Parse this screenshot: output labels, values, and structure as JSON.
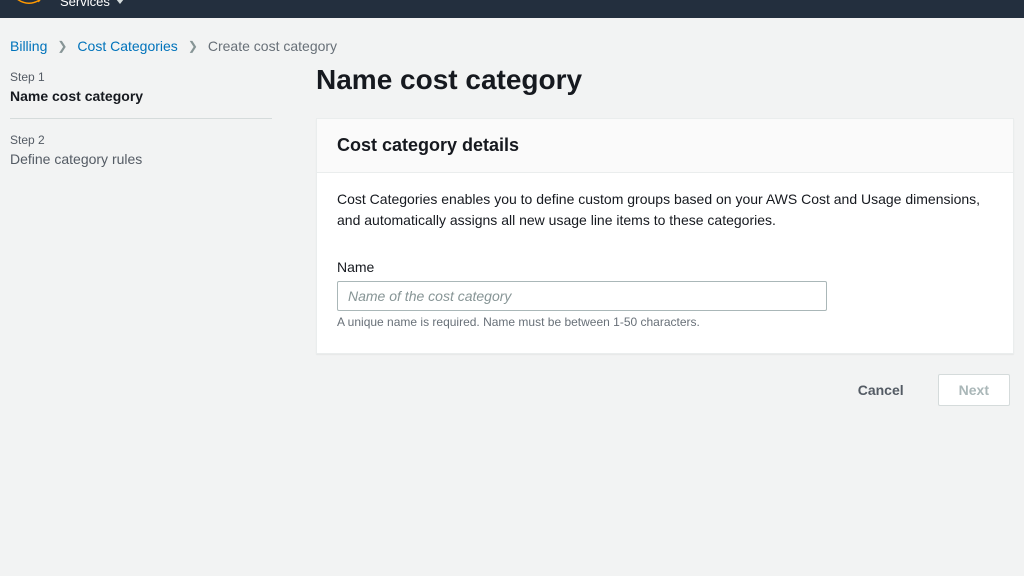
{
  "nav": {
    "services": "Services"
  },
  "breadcrumb": {
    "billing": "Billing",
    "categories": "Cost Categories",
    "current": "Create cost category"
  },
  "steps": [
    {
      "label": "Step 1",
      "title": "Name cost category",
      "active": true
    },
    {
      "label": "Step 2",
      "title": "Define category rules",
      "active": false
    }
  ],
  "page": {
    "title": "Name cost category"
  },
  "panel": {
    "heading": "Cost category details",
    "description": "Cost Categories enables you to define custom groups based on your AWS Cost and Usage dimensions, and automatically assigns all new usage line items to these categories.",
    "name_label": "Name",
    "name_placeholder": "Name of the cost category",
    "name_hint": "A unique name is required. Name must be between 1-50 characters."
  },
  "actions": {
    "cancel": "Cancel",
    "next": "Next"
  }
}
